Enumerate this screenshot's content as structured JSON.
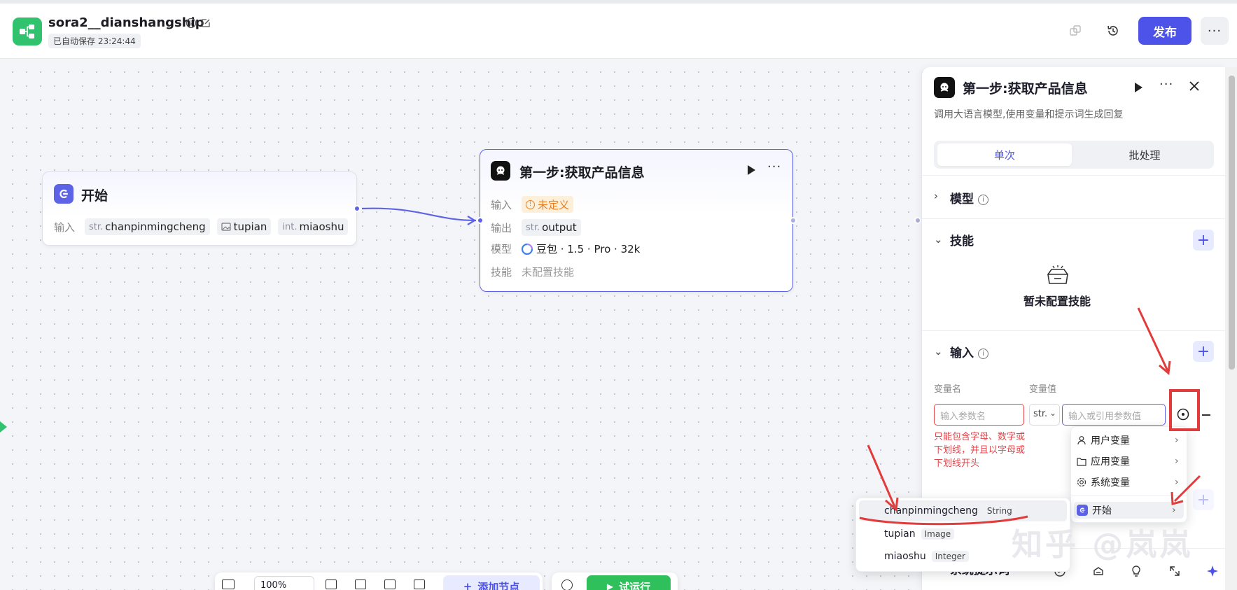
{
  "header": {
    "app_name": "sora2__dianshangship",
    "save_status": "已自动保存 23:24:44",
    "publish_label": "发布"
  },
  "start_node": {
    "title": "开始",
    "input_label": "输入",
    "inputs": [
      {
        "type": "str.",
        "name": "chanpinmingcheng"
      },
      {
        "type": "image",
        "name": "tupian"
      },
      {
        "type": "int.",
        "name": "miaoshu"
      }
    ]
  },
  "llm_node": {
    "title": "第一步:获取产品信息",
    "rows": {
      "input_label": "输入",
      "input_value": "未定义",
      "output_label": "输出",
      "output_type": "str.",
      "output_value": "output",
      "model_label": "模型",
      "model_value": "豆包 · 1.5 · Pro · 32k",
      "skill_label": "技能",
      "skill_value": "未配置技能"
    }
  },
  "panel": {
    "title": "第一步:获取产品信息",
    "description": "调用大语言模型,使用变量和提示词生成回复",
    "tabs": [
      "单次",
      "批处理"
    ],
    "sections": {
      "model": "模型",
      "skills": "技能",
      "skills_empty": "暂未配置技能",
      "input": "输入",
      "system_prompt": "系统提示词"
    },
    "input_table": {
      "col_name": "变量名",
      "col_value": "变量值",
      "name_placeholder": "输入参数名",
      "type_value": "str.",
      "value_placeholder": "输入或引用参数值",
      "error": "只能包含字母、数字或下划线，并且以字母或下划线开头"
    }
  },
  "var_menu": {
    "items": [
      "用户变量",
      "应用变量",
      "系统变量",
      "开始"
    ]
  },
  "start_vars_menu": {
    "items": [
      {
        "name": "chanpinmingcheng",
        "type": "String"
      },
      {
        "name": "tupian",
        "type": "Image"
      },
      {
        "name": "miaoshu",
        "type": "Integer"
      }
    ]
  },
  "bottom_toolbar": {
    "zoom": "100%",
    "add_node": "添加节点",
    "run": "试运行"
  },
  "watermark": "知乎 @岚岚",
  "colors": {
    "accent": "#4d53e8",
    "brand_green": "#30c26d",
    "error": "#e0454a",
    "annotation_red": "#e23b3b"
  }
}
